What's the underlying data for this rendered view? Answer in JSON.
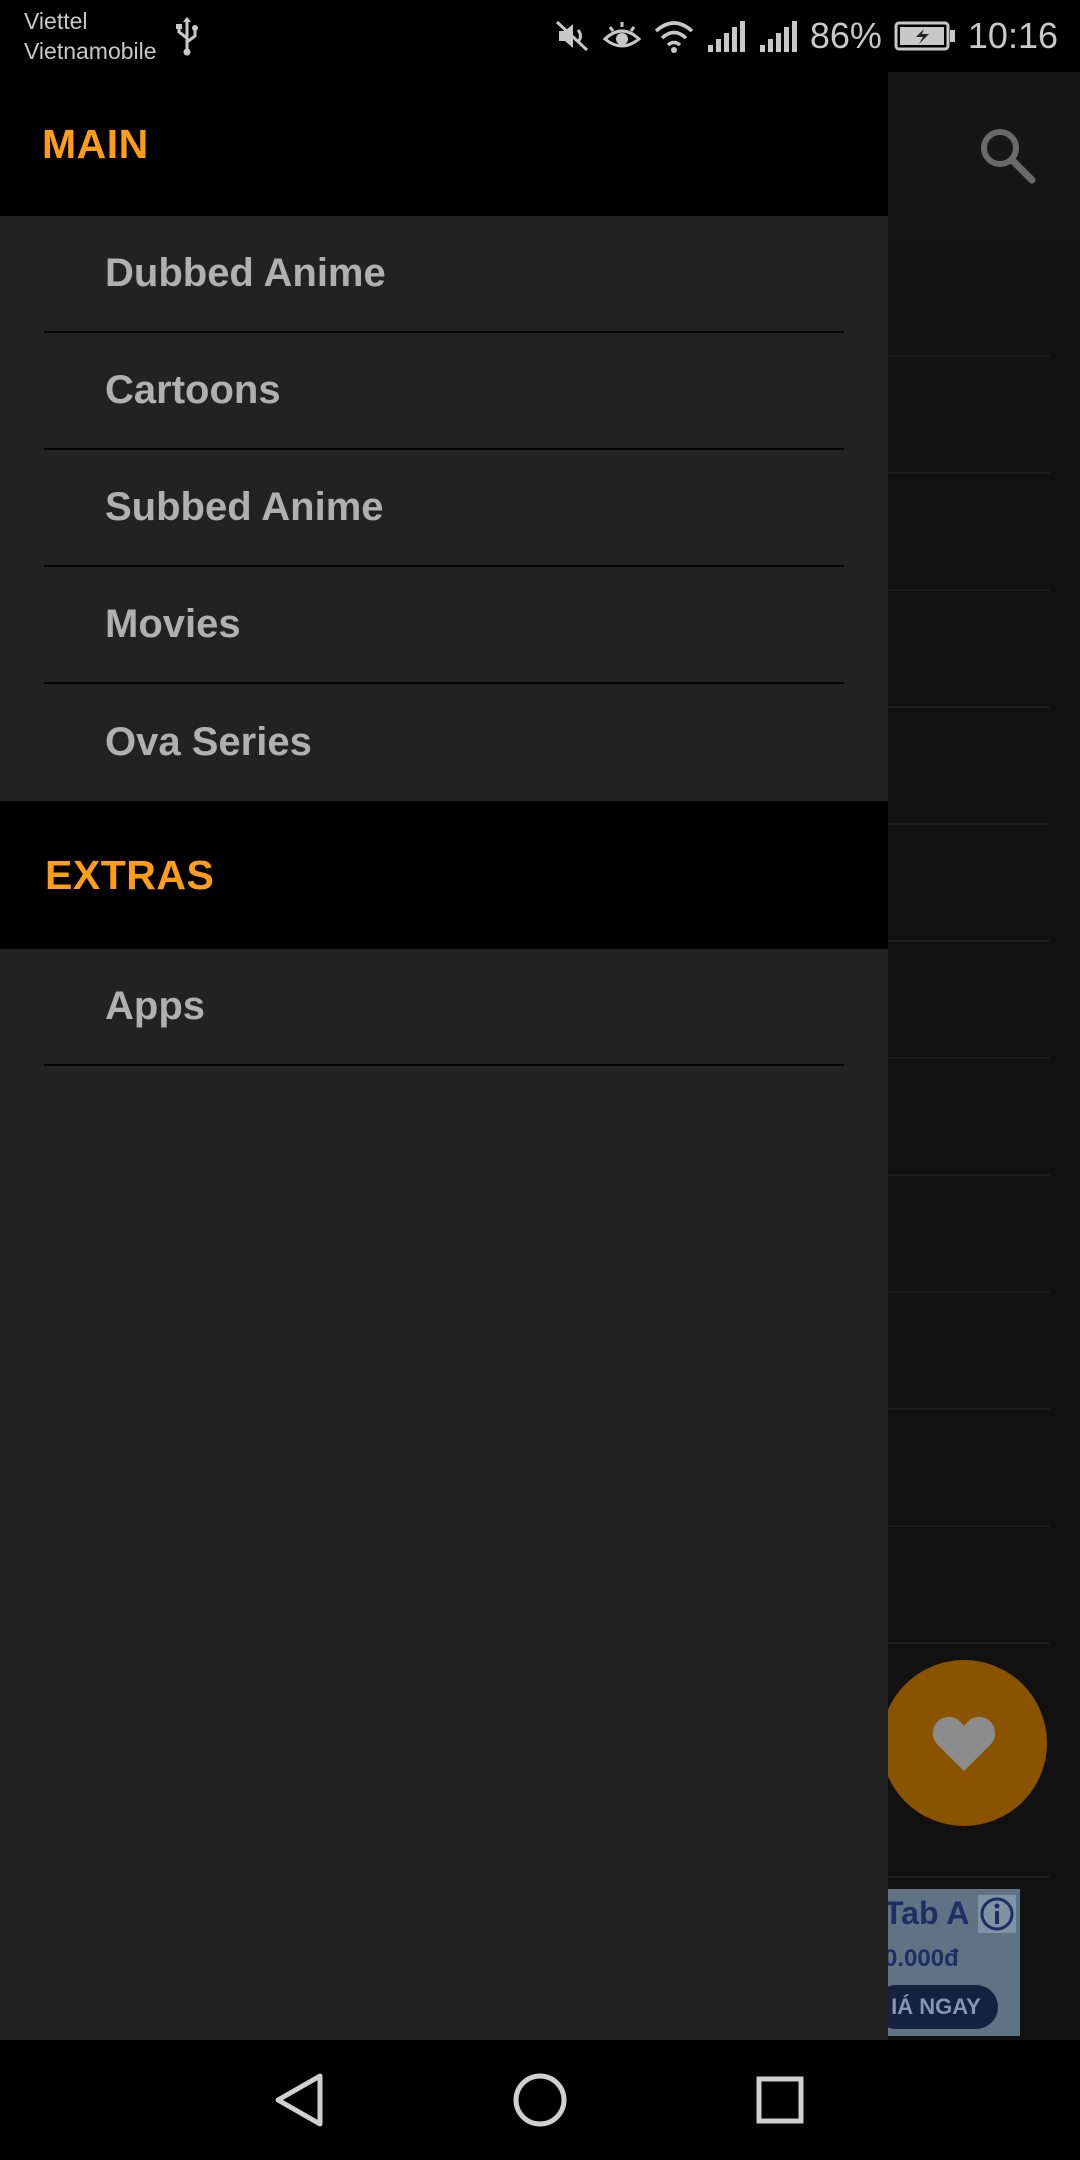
{
  "status_bar": {
    "carrier_line1": "Viettel",
    "carrier_line2": "Vietnamobile",
    "battery_percent": "86%",
    "time": "10:16"
  },
  "drawer": {
    "main_header": "MAIN",
    "main_items": [
      "Dubbed Anime",
      "Cartoons",
      "Subbed Anime",
      "Movies",
      "Ova Series"
    ],
    "extras_header": "EXTRAS",
    "extras_items": [
      "Apps"
    ]
  },
  "ad": {
    "title": "Tab A",
    "price": "0.000đ",
    "cta": "IÁ NGAY"
  },
  "colors": {
    "accent": "#ff9e16",
    "drawer_bg": "#222222",
    "header_bg": "#000000"
  },
  "icons": {
    "search": "search-icon",
    "favorite": "heart-icon",
    "nav_back": "back-triangle-icon",
    "nav_home": "home-circle-icon",
    "nav_recents": "recents-square-icon"
  }
}
